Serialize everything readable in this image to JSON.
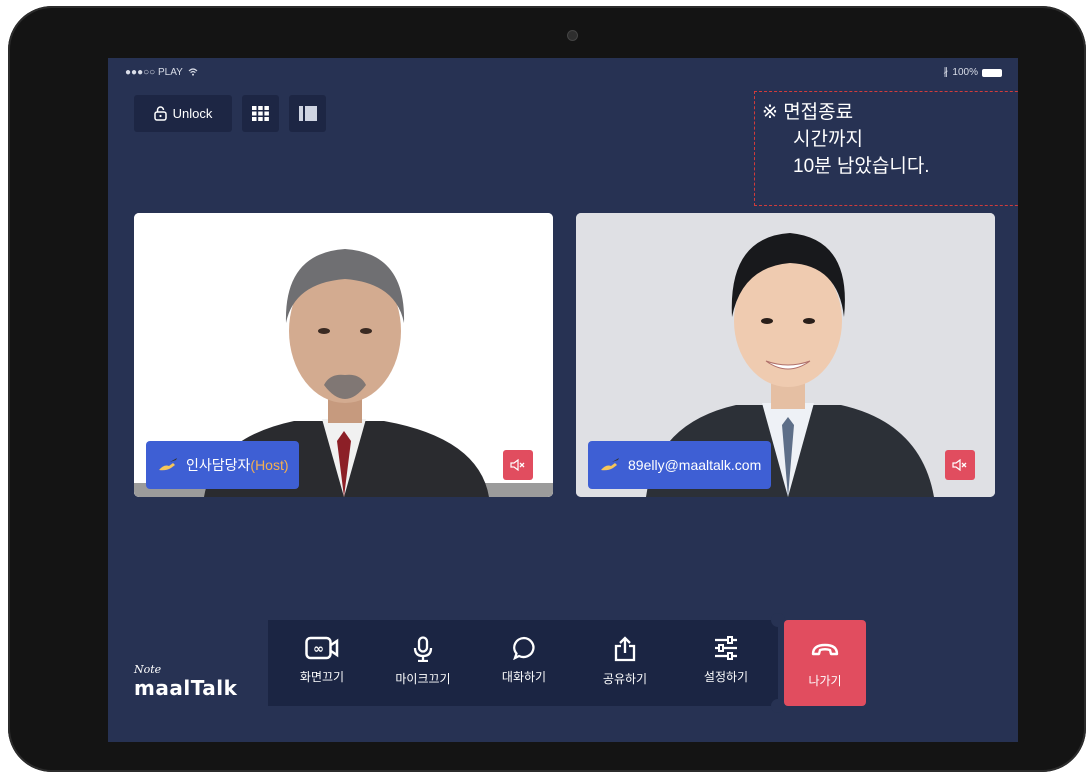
{
  "status_bar": {
    "carrier": "●●●○○ PLAY",
    "battery_text": "100%"
  },
  "toolbar": {
    "unlock_label": "Unlock",
    "grid_view_icon": "grid-icon",
    "side_view_icon": "sidebar-layout-icon"
  },
  "notice": {
    "line1": "※ 면접종료",
    "line2": "시간까지",
    "line3": "10분 남았습니다.",
    "close_label": "※",
    "border_color": "#d13b3b",
    "close_color": "#ec1d25"
  },
  "participants": [
    {
      "name": "인사담당자",
      "role": "(Host)",
      "icon": "pen-hand-icon",
      "mute_icon": "speaker-muted-icon"
    },
    {
      "name": "89elly@maaltalk.com",
      "role": "",
      "icon": "pen-hand-icon",
      "mute_icon": "speaker-muted-icon"
    }
  ],
  "controls": [
    {
      "label": "화면끄기",
      "icon": "video-camera-icon"
    },
    {
      "label": "마이크끄기",
      "icon": "microphone-icon"
    },
    {
      "label": "대화하기",
      "icon": "chat-bubble-icon"
    },
    {
      "label": "공유하기",
      "icon": "share-icon"
    },
    {
      "label": "설정하기",
      "icon": "settings-sliders-icon"
    }
  ],
  "leave": {
    "label": "나가기",
    "icon": "hang-up-icon",
    "color": "#e14d5f"
  },
  "logo": {
    "note": "Note",
    "brand": "maalTalk"
  },
  "colors": {
    "screen_bg": "#273253",
    "nametag": "#3e5fd4",
    "host_text": "#f6b04f"
  }
}
